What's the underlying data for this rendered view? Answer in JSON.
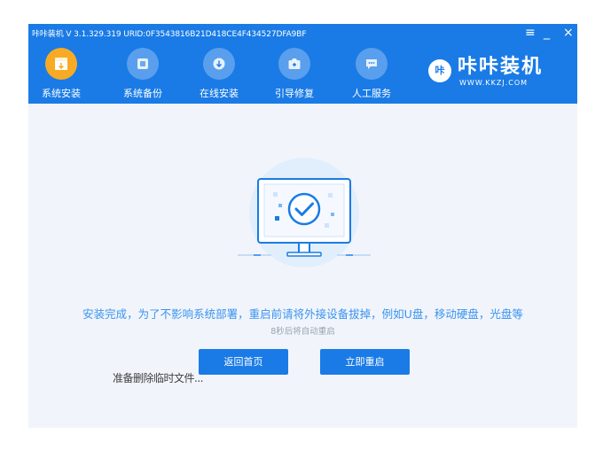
{
  "window": {
    "title": "咔咔装机 V 3.1.329.319 URID:0F3543816B21D418CE4F434527DFA9BF",
    "controls": {
      "menu": "≡",
      "minimize": "_",
      "close": "×"
    }
  },
  "nav": {
    "items": [
      {
        "label": "系统安装",
        "icon": "system-install-icon",
        "active": true
      },
      {
        "label": "系统备份",
        "icon": "system-backup-icon",
        "active": false
      },
      {
        "label": "在线安装",
        "icon": "online-install-icon",
        "active": false
      },
      {
        "label": "引导修复",
        "icon": "boot-repair-icon",
        "active": false
      },
      {
        "label": "人工服务",
        "icon": "chat-service-icon",
        "active": false
      }
    ]
  },
  "brand": {
    "logo_text": "咔",
    "name": "咔咔装机",
    "url": "WWW.KKZJ.COM"
  },
  "main": {
    "message": "安装完成，为了不影响系统部署，重启前请将外接设备拔掉，例如U盘，移动硬盘，光盘等",
    "countdown": "8秒后将自动重启",
    "back_button": "返回首页",
    "restart_button": "立即重启",
    "overlay_text": "准备删除临时文件..."
  },
  "colors": {
    "header": "#1a7be6",
    "accent": "#f7ab25",
    "body_bg": "#f1f5fb",
    "message": "#3b93f0"
  }
}
